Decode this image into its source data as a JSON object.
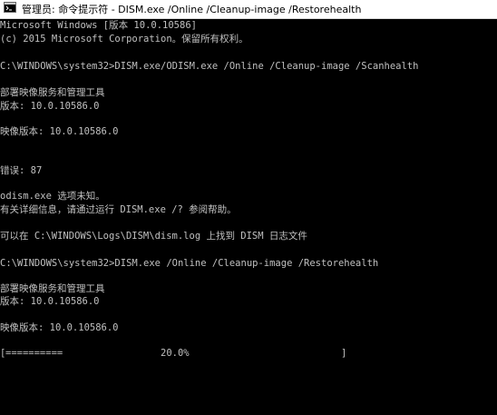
{
  "window": {
    "title": "管理员: 命令提示符 - DISM.exe  /Online /Cleanup-image /Restorehealth"
  },
  "console": {
    "lines": [
      "Microsoft Windows [版本 10.0.10586]",
      "(c) 2015 Microsoft Corporation。保留所有权利。",
      "C:\\WINDOWS\\system32>DISM.exe/ODISM.exe /Online /Cleanup-image /Scanhealth",
      "部署映像服务和管理工具",
      "版本: 10.0.10586.0",
      "映像版本: 10.0.10586.0",
      "错误: 87",
      "odism.exe 选项未知。",
      "有关详细信息，请通过运行 DISM.exe /? 参阅帮助。",
      "可以在 C:\\WINDOWS\\Logs\\DISM\\dism.log 上找到 DISM 日志文件",
      "C:\\WINDOWS\\system32>DISM.exe /Online /Cleanup-image /Restorehealth",
      "部署映像服务和管理工具",
      "版本: 10.0.10586.0",
      "映像版本: 10.0.10586.0"
    ],
    "progress": {
      "open": "[",
      "bar": "==========",
      "percent_text": "20.0%",
      "close": "]",
      "value": 0.2
    }
  }
}
